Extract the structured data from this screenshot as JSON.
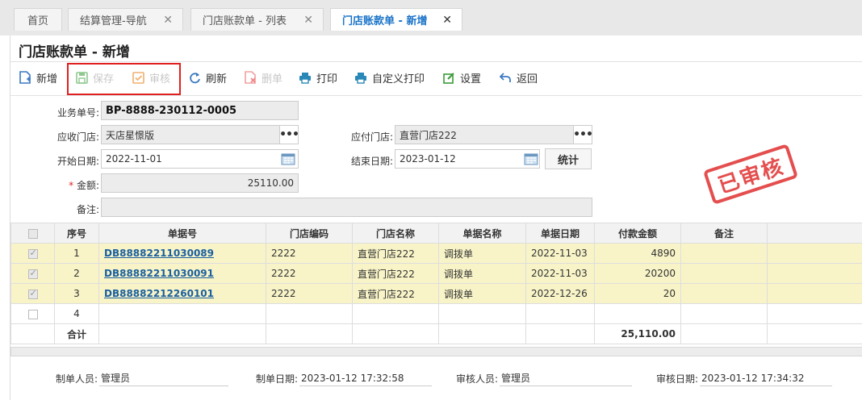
{
  "tabs": [
    {
      "label": "首页"
    },
    {
      "label": "结算管理-导航"
    },
    {
      "label": "门店账款单 - 列表"
    },
    {
      "label": "门店账款单 - 新增"
    }
  ],
  "page_title": "门店账款单 - 新增",
  "toolbar": {
    "new": "新增",
    "save": "保存",
    "audit": "审核",
    "refresh": "刷新",
    "delete": "删单",
    "print": "打印",
    "custom_print": "自定义打印",
    "settings": "设置",
    "back": "返回"
  },
  "form": {
    "doc_no_label": "业务单号:",
    "doc_no": "BP-8888-230112-0005",
    "recv_store_label": "应收门店:",
    "recv_store": "天店星憬版",
    "pay_store_label": "应付门店:",
    "pay_store": "直营门店222",
    "start_label": "开始日期:",
    "start": "2022-11-01",
    "end_label": "结束日期:",
    "end": "2023-01-12",
    "stat_btn": "统计",
    "amount_label": "金额:",
    "amount": "25110.00",
    "remark_label": "备注:",
    "remark": ""
  },
  "stamp": "已审核",
  "grid": {
    "headers": [
      "序号",
      "单据号",
      "门店编码",
      "门店名称",
      "单据名称",
      "单据日期",
      "付款金额",
      "备注"
    ],
    "rows": [
      {
        "no": "1",
        "doc": "DB88882211030089",
        "code": "2222",
        "name": "直营门店222",
        "type": "调拨单",
        "date": "2022-11-03",
        "amt": "4890",
        "remark": ""
      },
      {
        "no": "2",
        "doc": "DB88882211030091",
        "code": "2222",
        "name": "直营门店222",
        "type": "调拨单",
        "date": "2022-11-03",
        "amt": "20200",
        "remark": ""
      },
      {
        "no": "3",
        "doc": "DB88882212260101",
        "code": "2222",
        "name": "直营门店222",
        "type": "调拨单",
        "date": "2022-12-26",
        "amt": "20",
        "remark": ""
      },
      {
        "no": "4",
        "doc": "",
        "code": "",
        "name": "",
        "type": "",
        "date": "",
        "amt": "",
        "remark": ""
      }
    ],
    "total_label": "合计",
    "total": "25,110.00"
  },
  "footer": {
    "maker_label": "制单人员:",
    "maker": "管理员",
    "make_date_label": "制单日期:",
    "make_date": "2023-01-12 17:32:58",
    "auditor_label": "审核人员:",
    "auditor": "管理员",
    "audit_date_label": "审核日期:",
    "audit_date": "2023-01-12 17:34:32"
  },
  "colors": {
    "accent": "#1a73c8",
    "stamp": "#e23b3b",
    "selected_row": "#f8f4c8",
    "highlight_box": "#e02020"
  }
}
